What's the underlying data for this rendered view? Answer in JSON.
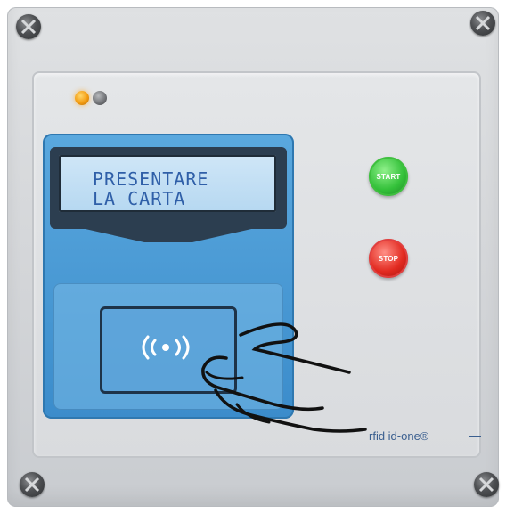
{
  "display": {
    "line1": "PRESENTARE",
    "line2": "LA CARTA"
  },
  "buttons": {
    "start_label": "START",
    "stop_label": "STOP"
  },
  "indicators": [
    {
      "name": "led-orange",
      "color": "#f39c12",
      "state": "on"
    },
    {
      "name": "led-gray",
      "color": "#6e7074",
      "state": "off"
    }
  ],
  "reader": {
    "icon": "contactless-wave-icon",
    "symbol": "((•))"
  },
  "brand": {
    "text": "rfid id-one®"
  },
  "colors": {
    "panel_blue": "#3b8ccb",
    "lcd_text": "#2f5fa8",
    "start_green": "#34c13a",
    "stop_red": "#e22a20"
  }
}
